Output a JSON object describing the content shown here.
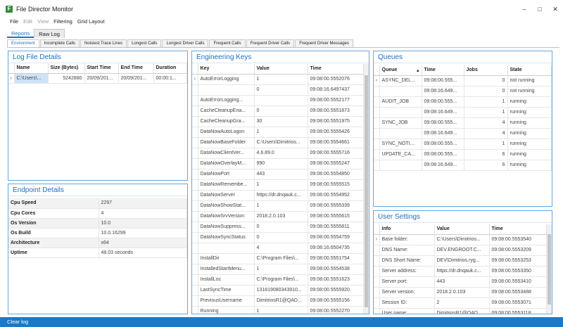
{
  "app": {
    "title": "File Director Monitor",
    "icon_letter": "F"
  },
  "window_buttons": [
    "–",
    "□",
    "✕"
  ],
  "menu": [
    {
      "label": "File",
      "enabled": true
    },
    {
      "label": "Edit",
      "enabled": false
    },
    {
      "label": "View",
      "enabled": false
    },
    {
      "label": "Filtering",
      "enabled": true
    },
    {
      "label": "Grid Layout",
      "enabled": true
    }
  ],
  "view_tabs": [
    "Reports",
    "Raw Log"
  ],
  "subtabs": [
    "Environment",
    "Incomplete Calls",
    "Noisiest Trace Lines",
    "Longest Calls",
    "Longest Driver Calls",
    "Frequent Calls",
    "Frequent Driver Calls",
    "Frequent Driver Messages"
  ],
  "log_file": {
    "title": "Log File Details",
    "columns": [
      "Name",
      "Size (Bytes)",
      "Start Time",
      "End Time",
      "Duration"
    ],
    "rows": [
      [
        "C:\\Users\\...",
        "5242880",
        "20/09/201...",
        "20/09/201...",
        "00:00:1..."
      ]
    ]
  },
  "endpoint": {
    "title": "Endpoint Details",
    "rows": [
      [
        "Cpu Speed",
        "2297"
      ],
      [
        "Cpu Cores",
        "4"
      ],
      [
        "Os Version",
        "10.0"
      ],
      [
        "Os Build",
        "10.0.16299"
      ],
      [
        "Architecture",
        "x64"
      ],
      [
        "Uptime",
        "48.03  seconds"
      ]
    ]
  },
  "engineering": {
    "title": "Engineering Keys",
    "columns": [
      "Key",
      "Value",
      "Time"
    ],
    "rows": [
      [
        "AutoErrorLogging",
        "1",
        "09:08:00.5552076"
      ],
      [
        "",
        "0",
        "09:08:16.6497437"
      ],
      [
        "AutoErrorLogging...",
        "",
        "09:08:00.5552177"
      ],
      [
        "CacheCleanupEna...",
        "0",
        "09:08:00.5551873"
      ],
      [
        "CacheCleanupGra...",
        "30",
        "09:08:00.5551975"
      ],
      [
        "DataNowAutoLogon",
        "1",
        "09:08:00.5555426"
      ],
      [
        "DataNowBaseFolder",
        "C:\\Users\\Dimitrios...",
        "09:08:00.5554661"
      ],
      [
        "DataNowClientVer...",
        "4.6.89.0",
        "09:08:00.5555716"
      ],
      [
        "DataNowOverlayM...",
        "990",
        "09:08:00.5555247"
      ],
      [
        "DataNowPort",
        "443",
        "09:08:00.5554850"
      ],
      [
        "DataNowRemembe...",
        "1",
        "09:08:00.5555515"
      ],
      [
        "DataNowServer",
        "https://dr.dnqauk.c...",
        "09:08:00.5554952"
      ],
      [
        "DataNowShowStat...",
        "1",
        "09:08:00.5555339"
      ],
      [
        "DataNowSrvVersion",
        "2018.2.0.103",
        "09:08:00.5555615"
      ],
      [
        "DataNowSuppress...",
        "0",
        "09:08:00.5555811"
      ],
      [
        "DataNowSyncStatus",
        "0",
        "09:08:00.5554759"
      ],
      [
        "",
        "4",
        "09:08:16.6504735"
      ],
      [
        "InstallDir",
        "C:\\Program Files\\...",
        "09:08:00.5551754"
      ],
      [
        "InstalledStartMenu...",
        "1",
        "09:08:00.5554538"
      ],
      [
        "InstallLoc",
        "C:\\Program Files\\...",
        "09:08:00.5551623"
      ],
      [
        "LastSyncTime",
        "131819080343910...",
        "09:08:00.5555920"
      ],
      [
        "PreviousUsername",
        "DimitriosR1@QAD...",
        "09:08:00.5555156"
      ],
      [
        "Running",
        "1",
        "09:08:00.5552270"
      ]
    ]
  },
  "queues": {
    "title": "Queues",
    "columns": [
      "Queue",
      "Time",
      "Jobs",
      "State"
    ],
    "rows": [
      [
        "ASYNC_DEL...",
        "09:08:00.555...",
        "0",
        "not running"
      ],
      [
        "",
        "09:08:16.649...",
        "0",
        "not running"
      ],
      [
        "AUDIT_JOB",
        "09:08:00.555...",
        "1",
        "running"
      ],
      [
        "",
        "09:08:16.649...",
        "1",
        "running"
      ],
      [
        "SYNC_JOB",
        "09:08:00.555...",
        "4",
        "running"
      ],
      [
        "",
        "09:08:16.649...",
        "4",
        "running"
      ],
      [
        "SYNC_NOTI...",
        "09:08:00.555...",
        "1",
        "running"
      ],
      [
        "UPDATE_CA...",
        "09:08:00.555...",
        "6",
        "running"
      ],
      [
        "",
        "09:08:16.649...",
        "6",
        "running"
      ]
    ]
  },
  "user_settings": {
    "title": "User Settings",
    "columns": [
      "Info",
      "Value",
      "Time"
    ],
    "rows": [
      [
        "Base folder:",
        "C:\\Users\\Dimitrios...",
        "09:08:00.5553540"
      ],
      [
        "DNS Name:",
        "DEV.ENGROOT.C...",
        "09:08:00.5553209"
      ],
      [
        "DNS Short Name:",
        "DEV\\Dimitrios.ryg...",
        "09:08:00.5553253"
      ],
      [
        "Server address:",
        "https://dr.dnqauk.c...",
        "09:08:00.5553350"
      ],
      [
        "Server port:",
        "443",
        "09:08:00.5553410"
      ],
      [
        "Server version:",
        "2018.2.0.103",
        "09:08:00.5553488"
      ],
      [
        "Session ID:",
        "2",
        "09:08:00.5553071"
      ],
      [
        "User name:",
        "DimitriosR1@QAD...",
        "09:08:00.5553118"
      ]
    ]
  },
  "status": {
    "text": "Clear log"
  }
}
